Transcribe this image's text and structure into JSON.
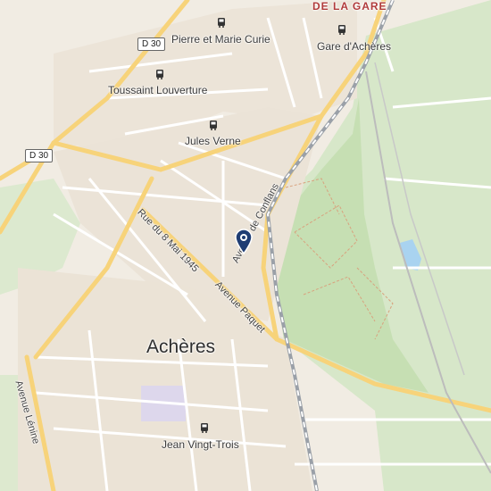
{
  "map": {
    "district_label": "DE LA GARE",
    "town_label": "Achères",
    "road_shields": [
      "D 30",
      "D 30"
    ],
    "stops": [
      {
        "name": "Pierre et Marie Curie",
        "icon": "bus-icon"
      },
      {
        "name": "Gare d'Achères",
        "icon": "bus-icon"
      },
      {
        "name": "Toussaint Louverture",
        "icon": "bus-icon"
      },
      {
        "name": "Jules Verne",
        "icon": "bus-icon"
      },
      {
        "name": "Jean Vingt-Trois",
        "icon": "bus-icon"
      }
    ],
    "streets": [
      "Rue du 8 Mai 1945",
      "Avenue Paquet",
      "Avenue de Conflans",
      "Avenue Lénine"
    ],
    "colors": {
      "background": "#f1ece3",
      "park": "#cfe3c1",
      "water": "#a9d3f0",
      "major_road": "#f7d37a",
      "railway": "#9aa0a8",
      "pin": "#1f3d73",
      "district_text": "#b03a3a"
    },
    "marker_icon": "location-pin-icon"
  }
}
